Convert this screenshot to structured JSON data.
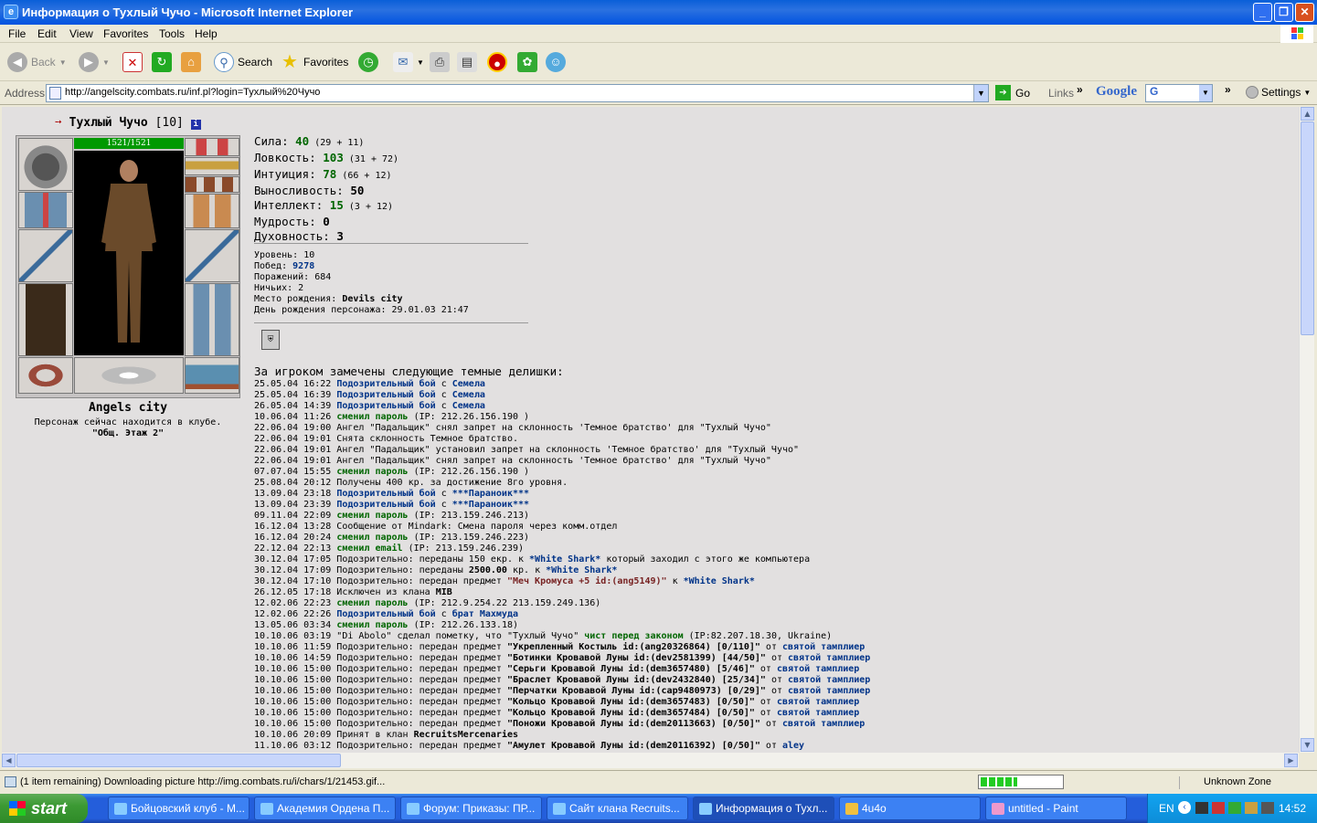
{
  "window": {
    "title": "Информация о Тухлый Чучо - Microsoft Internet Explorer",
    "minimize": "_",
    "maximize": "❐",
    "close": "✕"
  },
  "menu": [
    "File",
    "Edit",
    "View",
    "Favorites",
    "Tools",
    "Help"
  ],
  "toolbar": {
    "back": "Back",
    "search": "Search",
    "favorites": "Favorites"
  },
  "address": {
    "label": "Address",
    "url": "http://angelscity.combats.ru/inf.pl?login=Тухлый%20Чучо",
    "go": "Go",
    "links": "Links",
    "google": "Google",
    "google_box": "G",
    "settings": "Settings"
  },
  "character": {
    "name": "Тухлый Чучо",
    "level": "[10]",
    "hp": "1521/1521",
    "city": "Angels city",
    "location_text": "Персонаж сейчас находится в клубе.",
    "location_room": "\"Общ. Этаж 2\""
  },
  "stats": [
    {
      "label": "Сила:",
      "value": "40",
      "detail": "(29 + 11)"
    },
    {
      "label": "Ловкость:",
      "value": "103",
      "detail": "(31 + 72)"
    },
    {
      "label": "Интуиция:",
      "value": "78",
      "detail": "(66 + 12)"
    },
    {
      "label": "Выносливость:",
      "value": "50",
      "detail": ""
    },
    {
      "label": "Интеллект:",
      "value": "15",
      "detail": "(3 + 12)"
    },
    {
      "label": "Мудрость:",
      "value": "0",
      "detail": ""
    },
    {
      "label": "Духовность:",
      "value": "3",
      "detail": ""
    }
  ],
  "info": [
    {
      "label": "Уровень:",
      "value": "10",
      "style": "plain"
    },
    {
      "label": "Побед:",
      "value": "9278",
      "style": "link"
    },
    {
      "label": "Поражений:",
      "value": "684",
      "style": "plain"
    },
    {
      "label": "Ничьих:",
      "value": "2",
      "style": "plain"
    },
    {
      "label": "Место рождения:",
      "value": "Devils city",
      "style": "bold"
    },
    {
      "label": "День рождения персонажа:",
      "value": "29.01.03 21:47",
      "style": "plain"
    }
  ],
  "log_title": "За игроком замечены следующие темные делишки:",
  "log": [
    [
      [
        "t",
        "25.05.04 16:22 "
      ],
      [
        "l",
        "Подозрительный бой"
      ],
      [
        "t",
        " с "
      ],
      [
        "l",
        "Семела"
      ]
    ],
    [
      [
        "t",
        "25.05.04 16:39 "
      ],
      [
        "l",
        "Подозрительный бой"
      ],
      [
        "t",
        " с "
      ],
      [
        "l",
        "Семела"
      ]
    ],
    [
      [
        "t",
        "26.05.04 14:39 "
      ],
      [
        "l",
        "Подозрительный бой"
      ],
      [
        "t",
        " с "
      ],
      [
        "l",
        "Семела"
      ]
    ],
    [
      [
        "t",
        "10.06.04 11:26 "
      ],
      [
        "g",
        "сменил пароль"
      ],
      [
        "t",
        " (IP: 212.26.156.190 )"
      ]
    ],
    [
      [
        "t",
        "22.06.04 19:00 Ангел \"Падальщик\" снял запрет на склонность 'Темное братство' для \"Тухлый Чучо\""
      ]
    ],
    [
      [
        "t",
        "22.06.04 19:01 Снята склонность Темное братство."
      ]
    ],
    [
      [
        "t",
        "22.06.04 19:01 Ангел \"Падальщик\" установил запрет на склонность 'Темное братство' для \"Тухлый Чучо\""
      ]
    ],
    [
      [
        "t",
        "22.06.04 19:01 Ангел \"Падальщик\" снял запрет на склонность 'Темное братство' для \"Тухлый Чучо\""
      ]
    ],
    [
      [
        "t",
        "07.07.04 15:55 "
      ],
      [
        "g",
        "сменил пароль"
      ],
      [
        "t",
        " (IP: 212.26.156.190 )"
      ]
    ],
    [
      [
        "t",
        "25.08.04 20:12 Получены 400 кр. за достижение 8го уровня."
      ]
    ],
    [
      [
        "t",
        "13.09.04 23:18 "
      ],
      [
        "l",
        "Подозрительный бой"
      ],
      [
        "t",
        " с "
      ],
      [
        "l",
        "***Параноик***"
      ]
    ],
    [
      [
        "t",
        "13.09.04 23:39 "
      ],
      [
        "l",
        "Подозрительный бой"
      ],
      [
        "t",
        " с "
      ],
      [
        "l",
        "***Параноик***"
      ]
    ],
    [
      [
        "t",
        "09.11.04 22:09 "
      ],
      [
        "g",
        "сменил пароль"
      ],
      [
        "t",
        " (IP: 213.159.246.213)"
      ]
    ],
    [
      [
        "t",
        "16.12.04 13:28 Сообщение от Mindark: Смена пароля через комм.отдел"
      ]
    ],
    [
      [
        "t",
        "16.12.04 20:24 "
      ],
      [
        "g",
        "сменил пароль"
      ],
      [
        "t",
        " (IP: 213.159.246.223)"
      ]
    ],
    [
      [
        "t",
        "22.12.04 22:13 "
      ],
      [
        "g",
        "сменил email"
      ],
      [
        "t",
        " (IP: 213.159.246.239)"
      ]
    ],
    [
      [
        "t",
        "30.12.04 17:05 Подозрительно: переданы 150 екр. к "
      ],
      [
        "l",
        "*White Shark*"
      ],
      [
        "t",
        " который заходил с этого же компьютера"
      ]
    ],
    [
      [
        "t",
        "30.12.04 17:09 Подозрительно: переданы "
      ],
      [
        "b",
        "2500.00"
      ],
      [
        "t",
        " кр. к "
      ],
      [
        "l",
        "*White Shark*"
      ]
    ],
    [
      [
        "t",
        "30.12.04 17:10 Подозрительно: передан предмет "
      ],
      [
        "r",
        "\"Меч Кромуса +5 id:(ang5149)\""
      ],
      [
        "t",
        " к "
      ],
      [
        "l",
        "*White Shark*"
      ]
    ],
    [
      [
        "t",
        "26.12.05 17:18 Исключен из клана "
      ],
      [
        "b",
        "MIB"
      ]
    ],
    [
      [
        "t",
        "12.02.06 22:23 "
      ],
      [
        "g",
        "сменил пароль"
      ],
      [
        "t",
        " (IP: 212.9.254.22 213.159.249.136)"
      ]
    ],
    [
      [
        "t",
        "12.02.06 22:26 "
      ],
      [
        "l",
        "Подозрительный бой"
      ],
      [
        "t",
        " с "
      ],
      [
        "l",
        "брат Махмуда"
      ]
    ],
    [
      [
        "t",
        "13.05.06 03:34 "
      ],
      [
        "g",
        "сменил пароль"
      ],
      [
        "t",
        " (IP: 212.26.133.18)"
      ]
    ],
    [
      [
        "t",
        "10.10.06 03:19 \"Di Abolo\" сделал пометку, что \"Тухлый Чучо\" "
      ],
      [
        "g",
        "чист перед законом"
      ],
      [
        "t",
        " (IP:82.207.18.30, Ukraine)"
      ]
    ],
    [
      [
        "t",
        "10.10.06 11:59 Подозрительно: передан предмет "
      ],
      [
        "b",
        "\"Укрепленный Костыль id:(ang20326864) [0/110]\""
      ],
      [
        "t",
        " от "
      ],
      [
        "l",
        "святой тамплиер"
      ]
    ],
    [
      [
        "t",
        "10.10.06 14:59 Подозрительно: передан предмет "
      ],
      [
        "b",
        "\"Ботинки Кровавой Луны id:(dev2581399) [44/50]\""
      ],
      [
        "t",
        " от "
      ],
      [
        "l",
        "святой тамплиер"
      ]
    ],
    [
      [
        "t",
        "10.10.06 15:00 Подозрительно: передан предмет "
      ],
      [
        "b",
        "\"Серьги Кровавой Луны id:(dem3657480) [5/46]\""
      ],
      [
        "t",
        " от "
      ],
      [
        "l",
        "святой тамплиер"
      ]
    ],
    [
      [
        "t",
        "10.10.06 15:00 Подозрительно: передан предмет "
      ],
      [
        "b",
        "\"Браслет Кровавой Луны id:(dev2432840) [25/34]\""
      ],
      [
        "t",
        " от "
      ],
      [
        "l",
        "святой тамплиер"
      ]
    ],
    [
      [
        "t",
        "10.10.06 15:00 Подозрительно: передан предмет "
      ],
      [
        "b",
        "\"Перчатки Кровавой Луны id:(cap9480973) [0/29]\""
      ],
      [
        "t",
        " от "
      ],
      [
        "l",
        "святой тамплиер"
      ]
    ],
    [
      [
        "t",
        "10.10.06 15:00 Подозрительно: передан предмет "
      ],
      [
        "b",
        "\"Кольцо Кровавой Луны id:(dem3657483) [0/50]\""
      ],
      [
        "t",
        " от "
      ],
      [
        "l",
        "святой тамплиер"
      ]
    ],
    [
      [
        "t",
        "10.10.06 15:00 Подозрительно: передан предмет "
      ],
      [
        "b",
        "\"Кольцо Кровавой Луны id:(dem3657484) [0/50]\""
      ],
      [
        "t",
        " от "
      ],
      [
        "l",
        "святой тамплиер"
      ]
    ],
    [
      [
        "t",
        "10.10.06 15:00 Подозрительно: передан предмет "
      ],
      [
        "b",
        "\"Поножи Кровавой Луны id:(dem20113663) [0/50]\""
      ],
      [
        "t",
        " от "
      ],
      [
        "l",
        "святой тамплиер"
      ]
    ],
    [
      [
        "t",
        "10.10.06 20:09 Принят в клан "
      ],
      [
        "b",
        "RecruitsMercenaries"
      ]
    ],
    [
      [
        "t",
        "11.10.06 03:12 Подозрительно: передан предмет "
      ],
      [
        "b",
        "\"Амулет Кровавой Луны id:(dem20116392) [0/50]\""
      ],
      [
        "t",
        " от "
      ],
      [
        "l",
        "aley"
      ]
    ]
  ],
  "status": {
    "text": "(1 item remaining) Downloading picture http://img.combats.ru/i/chars/1/21453.gif...",
    "progress": 0.45,
    "zone": "Unknown Zone"
  },
  "taskbar": {
    "start": "start",
    "tasks": [
      "Бойцовский клуб - M...",
      "Академия Ордена П...",
      "Форум: Приказы: ПР...",
      "Сайт клана Recruits...",
      "Информация о Тухл...",
      "4u4o",
      "untitled - Paint"
    ],
    "lang": "EN",
    "clock": "14:52"
  }
}
